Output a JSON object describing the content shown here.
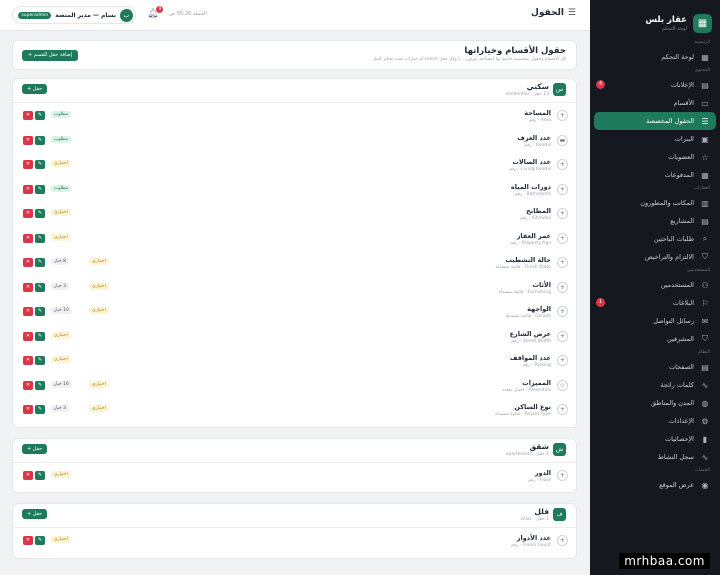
{
  "sidebar": {
    "brand": {
      "name": "عقار بلس",
      "sub": "لوحة التحكم",
      "logo_icon": "grid-icon"
    },
    "sections": [
      {
        "label": "الرئيسية",
        "items": [
          {
            "label": "لوحة التحكم",
            "icon": "grid-icon"
          }
        ]
      },
      {
        "label": "المحتوى",
        "items": [
          {
            "label": "الإعلانات",
            "icon": "document-icon",
            "badge": "4"
          },
          {
            "label": "الأقسام",
            "icon": "folder-icon"
          },
          {
            "label": "الحقول المخصصة",
            "icon": "list-icon",
            "active": true
          },
          {
            "label": "البنرات",
            "icon": "image-icon"
          },
          {
            "label": "العضويات",
            "icon": "star-icon"
          },
          {
            "label": "المدفوعات",
            "icon": "card-icon"
          }
        ]
      },
      {
        "label": "العقارات",
        "items": [
          {
            "label": "المكاتب والمطورون",
            "icon": "building-icon"
          },
          {
            "label": "المشاريع",
            "icon": "project-icon"
          },
          {
            "label": "طلبات الباحثين",
            "icon": "search-icon"
          },
          {
            "label": "الالتزام والتراخيص",
            "icon": "shield-icon"
          }
        ]
      },
      {
        "label": "المستخدمين",
        "items": [
          {
            "label": "المستخدمين",
            "icon": "users-icon"
          },
          {
            "label": "البلاغات",
            "icon": "flag-icon",
            "badge": "1"
          },
          {
            "label": "رسائل التواصل",
            "icon": "mail-icon"
          },
          {
            "label": "المشرفين",
            "icon": "shield-icon"
          }
        ]
      },
      {
        "label": "النظام",
        "items": [
          {
            "label": "الصفحات",
            "icon": "pages-icon"
          },
          {
            "label": "كلمات رائجة",
            "icon": "trend-icon"
          },
          {
            "label": "المدن والمناطق",
            "icon": "globe-icon"
          },
          {
            "label": "الإعدادات",
            "icon": "gear-icon"
          },
          {
            "label": "الإحصائيات",
            "icon": "chart-icon"
          },
          {
            "label": "سجل النشاط",
            "icon": "activity-icon"
          }
        ]
      },
      {
        "label": "الحساب",
        "items": [
          {
            "label": "عرض الموقع",
            "icon": "eye-icon"
          }
        ]
      }
    ]
  },
  "topbar": {
    "title": "الحقول",
    "time": "الجمعة 05:26 ص",
    "bell_count": "9",
    "user_name": "بسام — مدير المنصة",
    "user_role": "superadmin",
    "avatar": "ب"
  },
  "header": {
    "title": "حقول الأقسام وخياراتها",
    "subtitle": "كل الأقسام وحقول مخصصة خاصة بها (مساحة، غرف، ...) وكل حقل select له خيارات تحت تحكم كامل",
    "add_section_label": "+ إضافة حقل للقسم"
  },
  "labels": {
    "required": "مطلوب",
    "optional": "اختياري",
    "add_field": "+ حقل",
    "delete_btn": "✕",
    "edit_btn": "✎"
  },
  "categories": [
    {
      "icon": "س",
      "title": "سكني",
      "count": "13 حقل · residential",
      "fields": [
        {
          "name": "المساحة",
          "sub": "Area · رقم",
          "icon": "plus-circle-icon",
          "required": true
        },
        {
          "name": "عدد الغرف",
          "sub": "Rooms · رقم",
          "icon": "bed-icon",
          "required": true
        },
        {
          "name": "عدد الصالات",
          "sub": "Living Rooms · رقم",
          "icon": "plus-circle-icon",
          "required": false
        },
        {
          "name": "دورات المياه",
          "sub": "Bathrooms · رقم",
          "icon": "plus-circle-icon",
          "required": true
        },
        {
          "name": "المطابخ",
          "sub": "Kitchens · رقم",
          "icon": "plus-circle-icon",
          "required": false
        },
        {
          "name": "عمر العقار",
          "sub": "Property Age · رقم",
          "icon": "plus-circle-icon",
          "required": false
        },
        {
          "name": "حالة التشطيب",
          "sub": "Finish State · قائمة منسدلة",
          "icon": "plus-circle-icon",
          "required": false,
          "options": "8 خيار"
        },
        {
          "name": "الأثاث",
          "sub": "Furnishing · قائمة منسدلة",
          "icon": "plus-circle-icon",
          "required": false,
          "options": "3 خيار"
        },
        {
          "name": "الواجهة",
          "sub": "Facade · قائمة منسدلة",
          "icon": "plus-circle-icon",
          "required": false,
          "options": "10 خيار"
        },
        {
          "name": "عرض الشارع",
          "sub": "Street Width · رقم",
          "icon": "plus-circle-icon",
          "required": false
        },
        {
          "name": "عدد المواقف",
          "sub": "Parking · رقم",
          "icon": "plus-circle-icon",
          "required": false
        },
        {
          "name": "المميزات",
          "sub": "Amenities · اختيار متعدد",
          "icon": "star-icon",
          "required": false,
          "options": "16 خيار"
        },
        {
          "name": "نوع الساكن",
          "sub": "Tenant Type · قائمة منسدلة",
          "icon": "plus-circle-icon",
          "required": false,
          "options": "3 خيار"
        }
      ]
    },
    {
      "icon": "ش",
      "title": "شقق",
      "count": "1 حقل · apartments",
      "fields": [
        {
          "name": "الدور",
          "sub": "Floor · رقم",
          "icon": "plus-circle-icon",
          "required": false
        }
      ]
    },
    {
      "icon": "ف",
      "title": "فلل",
      "count": "1 حقل · villas",
      "fields": [
        {
          "name": "عدد الأدوار",
          "sub": "Floors Count · رقم",
          "icon": "plus-circle-icon",
          "required": false
        }
      ]
    }
  ],
  "watermark": "mrhbaa.com"
}
